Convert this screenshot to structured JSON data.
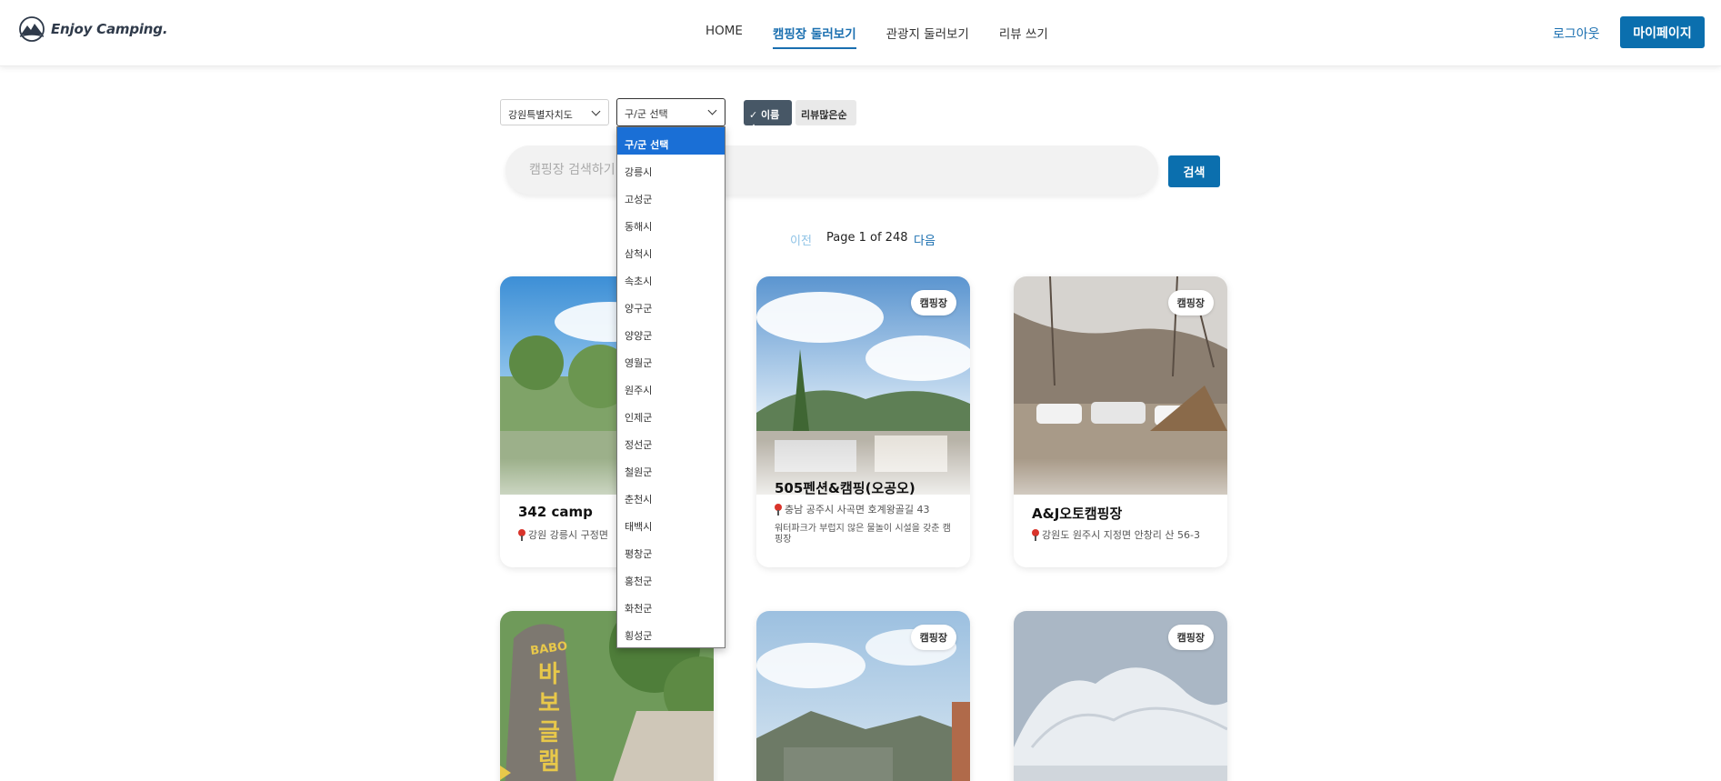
{
  "header": {
    "logo_text": "Enjoy Camping.",
    "nav": [
      "HOME",
      "캠핑장 둘러보기",
      "관광지 둘러보기",
      "리뷰 쓰기"
    ],
    "active_nav": 1,
    "logout_label": "로그아웃",
    "mypage_label": "마이페이지"
  },
  "filters": {
    "province_value": "강원특별자치도",
    "district_value": "구/군 선택",
    "sort_name_label": "✓ 이름순",
    "sort_review_label": "리뷰많은순",
    "district_options": [
      "구/군 선택",
      "강릉시",
      "고성군",
      "동해시",
      "삼척시",
      "속초시",
      "양구군",
      "양양군",
      "영월군",
      "원주시",
      "인제군",
      "정선군",
      "철원군",
      "춘천시",
      "태백시",
      "평창군",
      "홍천군",
      "화천군",
      "횡성군"
    ]
  },
  "search": {
    "placeholder": "캠핑장 검색하기",
    "button_label": "검색"
  },
  "pagination": {
    "prev_label": "이전",
    "page_info": "Page 1 of 248",
    "next_label": "다음"
  },
  "cards": [
    {
      "name": "342 camp",
      "address": "강원 강릉시 구정면",
      "desc": "",
      "badge": ""
    },
    {
      "name": "505펜션&캠핑(오공오)",
      "address": "충남 공주시 사곡면 호계왕골길 43",
      "desc": "워터파크가 부럽지 않은 물놀이 시설을 갖춘 캠핑장",
      "badge": "캠핑장"
    },
    {
      "name": "A&J오토캠핑장",
      "address": "강원도 원주시 지정면 안창리 산 56-3",
      "desc": "",
      "badge": "캠핑장"
    },
    {
      "name": "",
      "address": "",
      "desc": "",
      "badge": ""
    },
    {
      "name": "",
      "address": "",
      "desc": "",
      "badge": "캠핑장"
    },
    {
      "name": "",
      "address": "",
      "desc": "",
      "badge": "캠핑장"
    }
  ],
  "sign_text": "BABO 바보글램"
}
